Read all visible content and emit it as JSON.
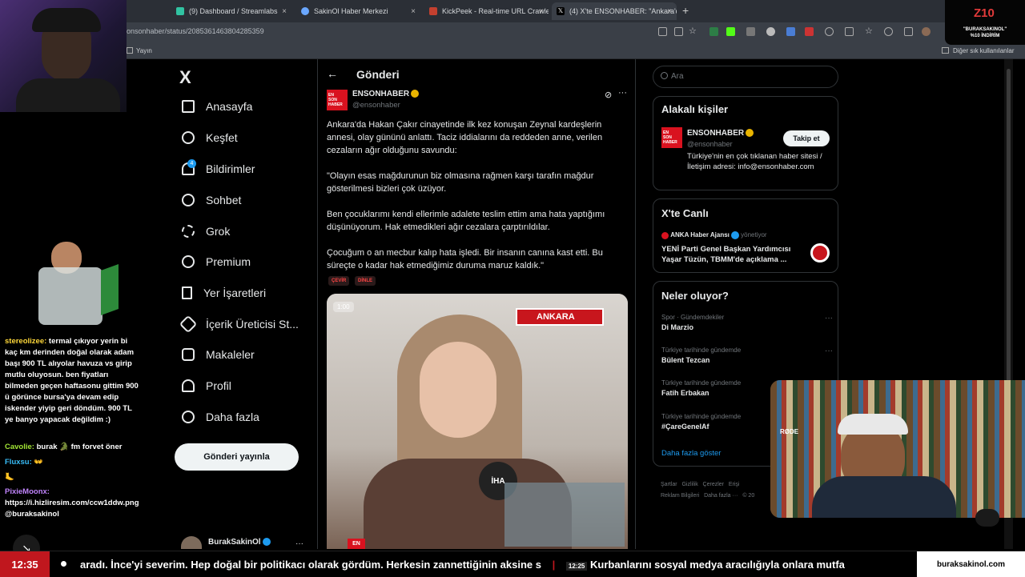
{
  "browser": {
    "tabs": [
      {
        "title": "(9) Dashboard / Streamlabs",
        "active": false
      },
      {
        "title": "SakinOl Haber Merkezi",
        "active": false
      },
      {
        "title": "KickPeek - Real-time URL Crawler",
        "active": false
      },
      {
        "title": "(4) X'te ENSONHABER: \"Ankara'da",
        "active": true
      }
    ],
    "url": "onsonhaber/status/2085361463804285359",
    "bookmark_left": "Yayın",
    "bookmark_right": "Diğer sık kullanılanlar"
  },
  "x_nav": {
    "logo": "X",
    "items": [
      {
        "label": "Anasayfa",
        "icon": "home-icon"
      },
      {
        "label": "Keşfet",
        "icon": "search-icon"
      },
      {
        "label": "Bildirimler",
        "icon": "bell-icon"
      },
      {
        "label": "Sohbet",
        "icon": "chat-icon"
      },
      {
        "label": "Grok",
        "icon": "grok-icon"
      },
      {
        "label": "Premium",
        "icon": "premium-icon"
      },
      {
        "label": "Yer İşaretleri",
        "icon": "bookmark-icon"
      },
      {
        "label": "İçerik Üreticisi St...",
        "icon": "rocket-icon"
      },
      {
        "label": "Makaleler",
        "icon": "articles-icon"
      },
      {
        "label": "Profil",
        "icon": "profile-icon"
      },
      {
        "label": "Daha fazla",
        "icon": "more-icon"
      }
    ],
    "notification_badge": "4",
    "post_button": "Gönderi yayınla",
    "account_name": "BurakSakinOl"
  },
  "post": {
    "header": "Gönderi",
    "author_name": "ENSONHABER",
    "author_handle": "@ensonhaber",
    "paragraphs": [
      "Ankara'da Hakan Çakır cinayetinde ilk kez konuşan Zeynal kardeşlerin annesi, olay gününü anlattı. Taciz iddialarını da reddeden anne, verilen cezaların ağır olduğunu savundu:",
      "\"Olayın esas mağdurunun biz olmasına rağmen karşı tarafın mağdur gösterilmesi bizleri çok üzüyor.",
      "Ben çocuklarımı kendi ellerimle adalete teslim ettim ama hata yaptığımı düşünüyorum. Hak etmedikleri ağır cezalara çarptırıldılar.",
      "Çocuğum o an mecbur kalıp hata işledi. Bir insanın canına kast etti. Bu süreçte o kadar hak etmediğimiz duruma maruz kaldık.\""
    ],
    "translate_label": "ÇEVİR",
    "listen_label": "DİNLE",
    "video_time": "1:00",
    "video_banner": "ANKARA",
    "video_logo": "İHA",
    "video_badge": "EN"
  },
  "sidebar": {
    "search_placeholder": "Ara",
    "related_title": "Alakalı kişiler",
    "related_name": "ENSONHABER",
    "related_handle": "@ensonhaber",
    "follow_label": "Takip et",
    "related_bio": "Türkiye'nin en çok tıklanan haber sitesi / İletişim adresi: info@ensonhaber.com",
    "live_title": "X'te Canlı",
    "live_source": "ANKA Haber Ajansı",
    "live_role": "yönetiyor",
    "live_text": "YENİ Parti Genel Başkan Yardımcısı Yaşar Tüzün, TBMM'de açıklama ...",
    "trends_title": "Neler oluyor?",
    "trends": [
      {
        "category": "Spor · Gündemdekiler",
        "name": "Di Marzio"
      },
      {
        "category": "Türkiye tarihinde gündemde",
        "name": "Bülent Tezcan"
      },
      {
        "category": "Türkiye tarihinde gündemde",
        "name": "Fatih Erbakan"
      },
      {
        "category": "Türkiye tarihinde gündemde",
        "name": "#ÇareGenelAf"
      }
    ],
    "show_more": "Daha fazla göster",
    "footer_links": [
      "Şartlar",
      "Gizlilik",
      "Çerezler",
      "Erişi",
      "Reklam Bilgileri",
      "Daha fazla ···",
      "© 20"
    ]
  },
  "chat": {
    "messages": [
      {
        "user": "stereolizee:",
        "text": "termal çıkıyor yerin bi kaç km derinden doğal olarak adam başı 900 TL alıyolar havuza vs girip mutlu oluyosun. ben fiyatları bilmeden geçen haftasonu gittim 900 ü görünce bursa'ya devam edip iskender yiyip geri döndüm. 900 TL ye banyo yapacak değildim :)"
      },
      {
        "user": "Cavolie:",
        "text": "burak 🐊 fm forvet öner"
      },
      {
        "user": "Fluxsu:",
        "text": "👐"
      },
      {
        "user": "",
        "text": "🦶"
      },
      {
        "user": "PixieMoonx:",
        "text": "https://i.hizliresim.com/ccw1ddw.png @buraksakinol"
      }
    ]
  },
  "ticker": {
    "clock": "12:35",
    "text": "aradı. İnce'yi severim. Hep doğal bir politikacı olarak gördüm. Herkesin zannettiğinin aksine s",
    "time2": "12:25",
    "text2": "Kurbanlarını sosyal medya aracılığıyla onlara mutfa",
    "brand": "buraksakinol.com"
  },
  "promo": {
    "logo": "Z10",
    "line1": "\"BURAKSAKINOL\"",
    "line2": "%10 İNDİRİM"
  },
  "webcam_label": "RØDE"
}
